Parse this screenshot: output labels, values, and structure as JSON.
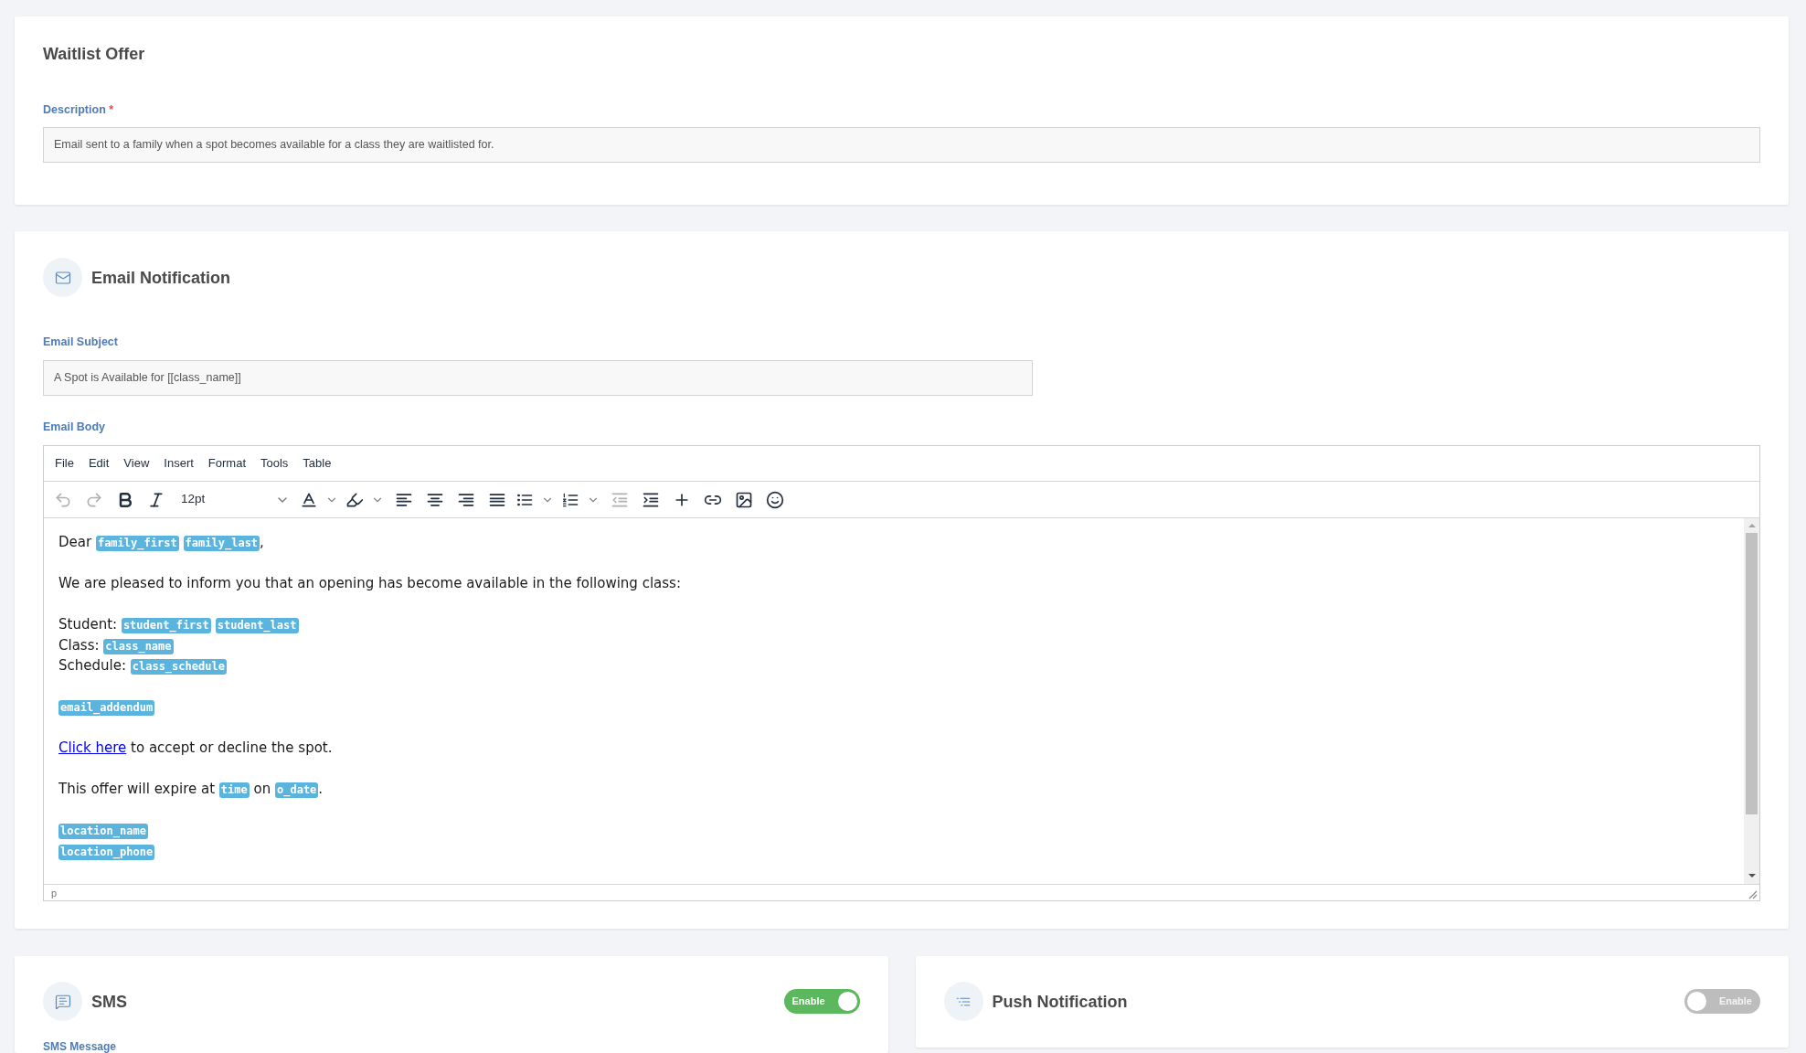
{
  "waitlist_card": {
    "title": "Waitlist Offer",
    "description_field": {
      "label": "Description",
      "required_mark": "*",
      "value": "Email sent to a family when a spot becomes available for a class they are waitlisted for."
    }
  },
  "email_card": {
    "title": "Email Notification",
    "subject_field": {
      "label": "Email Subject",
      "value": "A Spot is Available for [[class_name]]"
    },
    "body_field": {
      "label": "Email Body",
      "menu": [
        "File",
        "Edit",
        "View",
        "Insert",
        "Format",
        "Tools",
        "Table"
      ],
      "toolbar": [
        {
          "kind": "undo",
          "disabled": true
        },
        {
          "kind": "redo",
          "disabled": true
        },
        {
          "kind": "bold",
          "disabled": false
        },
        {
          "kind": "italic",
          "disabled": false
        },
        {
          "kind": "fontsize",
          "value": "12pt",
          "disabled": false
        },
        {
          "kind": "textcolor",
          "disabled": false
        },
        {
          "kind": "highlight",
          "disabled": false
        },
        {
          "kind": "alignleft",
          "disabled": false
        },
        {
          "kind": "aligncenter",
          "disabled": false
        },
        {
          "kind": "alignright",
          "disabled": false
        },
        {
          "kind": "justify",
          "disabled": false
        },
        {
          "kind": "bulletlist",
          "disabled": false
        },
        {
          "kind": "numberlist",
          "disabled": false
        },
        {
          "kind": "outdent",
          "disabled": true
        },
        {
          "kind": "indent",
          "disabled": false
        },
        {
          "kind": "insert",
          "disabled": false
        },
        {
          "kind": "link",
          "disabled": false
        },
        {
          "kind": "image",
          "disabled": false
        },
        {
          "kind": "emoji",
          "disabled": false
        }
      ],
      "paragraphs": [
        {
          "lines": [
            [
              {
                "kind": "text",
                "text": "Dear "
              },
              {
                "kind": "tag",
                "text": "family_first"
              },
              {
                "kind": "tag",
                "text": "family_last"
              },
              {
                "kind": "text",
                "text": ","
              }
            ]
          ]
        },
        {
          "lines": [
            [
              {
                "kind": "text",
                "text": "We are pleased to inform you that an opening has become available in the following class:"
              }
            ]
          ]
        },
        {
          "lines": [
            [
              {
                "kind": "text",
                "text": "Student: "
              },
              {
                "kind": "tag",
                "text": "student_first"
              },
              {
                "kind": "tag",
                "text": "student_last"
              }
            ],
            [
              {
                "kind": "text",
                "text": "Class: "
              },
              {
                "kind": "tag",
                "text": "class_name"
              }
            ],
            [
              {
                "kind": "text",
                "text": "Schedule: "
              },
              {
                "kind": "tag",
                "text": "class_schedule"
              }
            ]
          ]
        },
        {
          "lines": [
            [
              {
                "kind": "tag",
                "text": "email_addendum"
              }
            ]
          ]
        },
        {
          "lines": [
            [
              {
                "kind": "link",
                "text": "Click here"
              },
              {
                "kind": "text",
                "text": " to accept or decline the spot."
              }
            ]
          ]
        },
        {
          "lines": [
            [
              {
                "kind": "text",
                "text": "This offer will expire at "
              },
              {
                "kind": "tag",
                "text": "time"
              },
              {
                "kind": "text",
                "text": " on "
              },
              {
                "kind": "tag",
                "text": "o_date"
              },
              {
                "kind": "text",
                "text": "."
              }
            ]
          ]
        },
        {
          "lines": [
            [
              {
                "kind": "tag",
                "text": "location_name"
              }
            ],
            [
              {
                "kind": "tag",
                "text": "location_phone"
              }
            ]
          ]
        }
      ],
      "status_path": "p"
    }
  },
  "sms_card": {
    "title": "SMS",
    "toggle": {
      "label": "Enable",
      "on": true
    },
    "message_label": "SMS Message"
  },
  "push_card": {
    "title": "Push Notification",
    "toggle": {
      "label": "Enable",
      "on": false
    }
  }
}
